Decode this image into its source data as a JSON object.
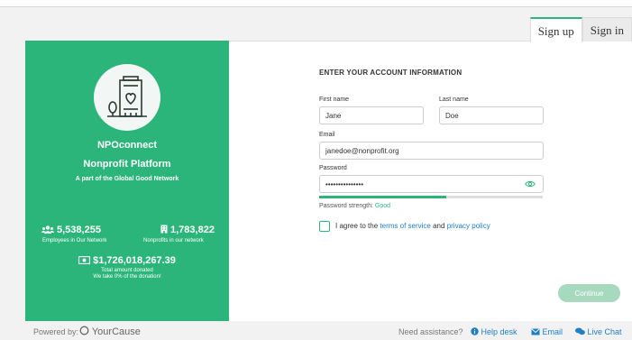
{
  "tabs": {
    "signup": "Sign up",
    "signin": "Sign in"
  },
  "brand_panel": {
    "name": "NPOconnect",
    "subtitle": "Nonprofit Platform",
    "network": "A part of the Global Good Network",
    "employees_value": "5,538,255",
    "employees_label": "Employees in Our Network",
    "nonprofits_value": "1,783,822",
    "nonprofits_label": "Nonprofits in our network",
    "donated_value": "$1,726,018,267.39",
    "donated_label": "Total amount donated",
    "donation_note": "We take 0% of the donation!"
  },
  "form": {
    "title": "ENTER YOUR ACCOUNT INFORMATION",
    "first_name_label": "First name",
    "first_name_value": "Jane",
    "last_name_label": "Last name",
    "last_name_value": "Doe",
    "email_label": "Email",
    "email_value": "janedoe@nonprofit.org",
    "password_label": "Password",
    "password_value": "•••••••••••••••",
    "strength_label": "Password strength:",
    "strength_value": "Good",
    "strength_fraction": 0.57,
    "agree_prefix": "I agree to the",
    "terms_link": "terms of service",
    "agree_and": "and",
    "privacy_link": "privacy policy",
    "continue_label": "Continue"
  },
  "footer": {
    "powered_by": "Powered by:",
    "brand": "YourCause",
    "assistance": "Need assistance?",
    "help_desk": "Help desk",
    "email": "Email",
    "live_chat": "Live Chat"
  },
  "colors": {
    "accent": "#2bb57a",
    "link": "#1e7fc4",
    "continue_disabled": "#a7d9bf"
  }
}
